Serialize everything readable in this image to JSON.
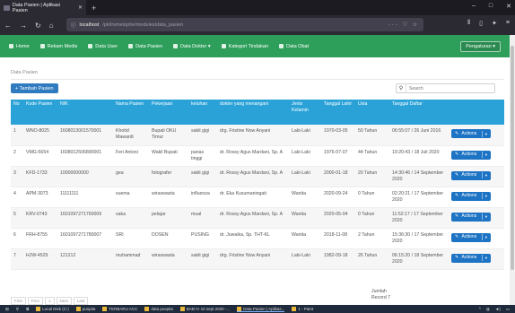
{
  "browser": {
    "tab_title": "Data Pasien | Aplikasi Pasien",
    "url_host": "localhost",
    "url_path": "/pkl/rsmetophe/modules/data_pasien",
    "window_controls": [
      "–",
      "□",
      "✕"
    ],
    "toolbar_icons": [
      "back-icon",
      "forward-icon",
      "reload-icon",
      "home-icon"
    ]
  },
  "navbar": {
    "items": [
      {
        "label": "Home",
        "icon": "home-icon"
      },
      {
        "label": "Rekam Medis",
        "icon": "records-icon"
      },
      {
        "label": "Data User",
        "icon": "user-icon"
      },
      {
        "label": "Data Pasien",
        "icon": "patient-icon"
      },
      {
        "label": "Data Dokter ▾",
        "icon": "doctor-icon"
      },
      {
        "label": "Kategori Tindakan",
        "icon": "category-icon"
      },
      {
        "label": "Data Obat",
        "icon": "medicine-icon"
      }
    ],
    "user_button": "Pengaturan ▾",
    "accent": "#2e9e5b"
  },
  "page": {
    "title": "Data Pasien",
    "add_button": "+ Tambah Pasien",
    "search_placeholder": "Search",
    "header_color": "#2aa2d8"
  },
  "table": {
    "headers": [
      "No",
      "Kode Pasien",
      "NIK",
      "Nama Pasien",
      "Pekerjaan",
      "keluhan",
      "dokter yang menangani",
      "Jenis Kelamin",
      "Tanggal Lahir",
      "Usia",
      "Tanggal Daftar",
      ""
    ],
    "rows": [
      [
        "1",
        "WNO-8025",
        "1608013001570001",
        "Khotid Mawardi",
        "Bupati OKU Timur",
        "sakit gigi",
        "drg. Fristine Now Anyani",
        "Laki-Laki",
        "1970-03-05",
        "50 Tahun",
        "06:55:07 / 26 Juni 2016"
      ],
      [
        "2",
        "VMG-5654",
        "1608012506890001",
        "Feri Antoni",
        "Wakil Bupati",
        "panas tinggi",
        "dr. Rossy Agus Mardani, Sp. A",
        "Laki-Laki",
        "1976-07-07",
        "44 Tahun",
        "19:20:43 / 18 Juli 2020"
      ],
      [
        "3",
        "KFD-1733",
        "10000000000",
        "gea",
        "fotografer",
        "sakit gigi",
        "dr. Rossy Agus Mardani, Sp. A",
        "Laki-Laki",
        "2000-01-18",
        "20 Tahun",
        "14:30:46 / 14 September 2020"
      ],
      [
        "4",
        "APM-3073",
        "11111111",
        "suema",
        "wiraswasta",
        "influenza",
        "dr. Eka Kusumaningati",
        "Wanita",
        "2020-09-24",
        "0 Tahun",
        "02:20:21 / 17 September 2020"
      ],
      [
        "5",
        "KRV-0743",
        "1601097271760009",
        "saka",
        "pelajar",
        "mual",
        "dr. Rossy Agus Mardani, Sp. A",
        "Wanita",
        "2020-05-04",
        "0 Tahun",
        "11:52:17 / 17 September 2020"
      ],
      [
        "6",
        "FRH-8755",
        "1601097271780007",
        "SRI",
        "DOSEN",
        "PUSING",
        "dr. Juwaika, Sp. THT-KL",
        "Wanita",
        "2018-11-08",
        "2 Tahun",
        "15:36:30 / 17 September 2020"
      ],
      [
        "7",
        "HJW-4529",
        "121212",
        "muhammad",
        "wiraswasta",
        "sakit gigi",
        "drg. Fristine Now Anyani",
        "Laki-Laki",
        "1982-09-18",
        "26 Tahun",
        "06:15:20 / 18 September 2020"
      ]
    ],
    "action_label": "Actions",
    "total_label": "Jumlah Record 7"
  },
  "pager": [
    "First",
    "Prev",
    "1",
    "Next",
    "Last"
  ],
  "taskbar": {
    "items": [
      "Local Disk (C:)",
      "puspita",
      "TERBARU ACC",
      "data puspita",
      "BAB IV 10 sept 2020 -...",
      "Data Pasien | Aplikas...",
      "1 - Paint"
    ],
    "active_index": 5
  }
}
